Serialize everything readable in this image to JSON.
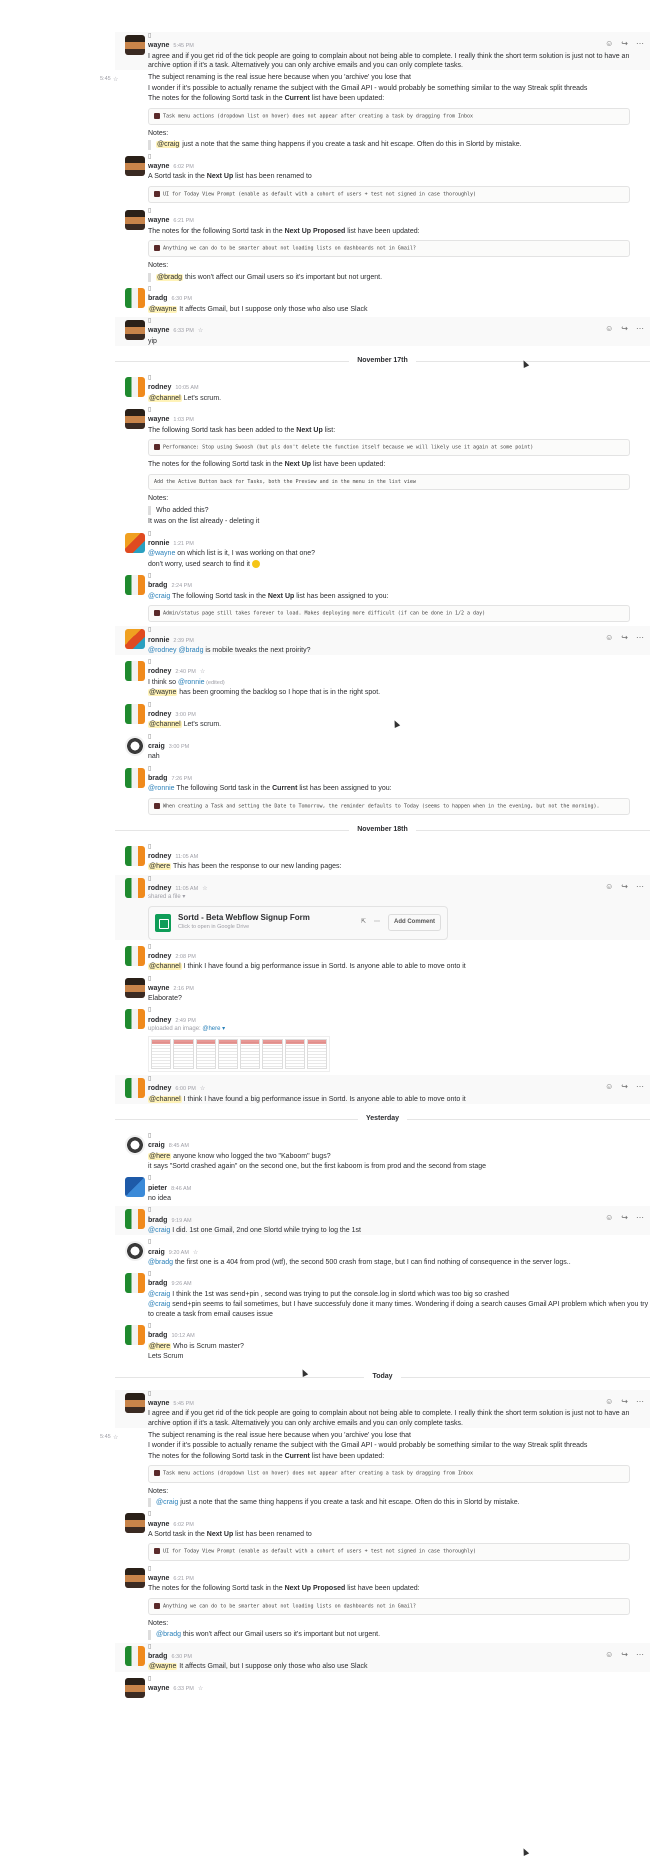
{
  "hover_actions": [
    "☺",
    "↪",
    "⋯"
  ],
  "days": [
    {
      "divider": "",
      "messages": [
        {
          "author": "wayne",
          "avatar": "wayne",
          "time": "5:45 PM",
          "lines": [
            {
              "t": "I agree and if you get rid of the tick people are going to complain about not being able to complete.  I really think the short term solution is just not to have an archive option if it's a task. Alternatively you can only archive emails and you can only complete tasks."
            }
          ],
          "hover": true
        },
        {
          "continued": true,
          "sidetime": "5:45",
          "star": true,
          "lines": [
            {
              "t": "The subject renaming is the real issue here because when you 'archive' you lose that"
            },
            {
              "t": "I wonder if it's possible to actually rename the subject with the Gmail API - would probably be something similar to the way Streak split threads"
            },
            {
              "t": "The notes for the following Sortd task in the ",
              "b": "Current",
              "t2": " list have been updated:"
            }
          ],
          "code": "Task menu actions (dropdown list on hover) does not appear after creating a task by dragging from Inbox",
          "notes": "Notes:",
          "quote": [
            {
              "m": "@craig",
              "t": " just a note that the same thing happens if you create a task and hit escape. Often do this in Slortd by mistake."
            }
          ]
        },
        {
          "author": "wayne",
          "avatar": "wayne",
          "time": "6:02 PM",
          "lines": [
            {
              "t": "A Sortd task in the ",
              "b": "Next Up",
              "t2": " list has been renamed to"
            }
          ],
          "code": "UI for Today View Prompt (enable as default with a cohort of users + test not signed in case thoroughly)"
        },
        {
          "author": "wayne",
          "avatar": "wayne",
          "time": "6:21 PM",
          "lines": [
            {
              "t": "The notes for the following Sortd task in the ",
              "b": "Next Up Proposed",
              "t2": " list have been updated:"
            }
          ],
          "code": "Anything we can do to be smarter about not loading lists on dashboards not in Gmail?",
          "notes": "Notes:",
          "quote": [
            {
              "m": "@bradg",
              "t": " this won't affect our Gmail users so it's important but not urgent."
            }
          ]
        },
        {
          "author": "bradg",
          "avatar": "bradg",
          "time": "6:30 PM",
          "lines": [
            {
              "m": "@wayne",
              "t": " It affects Gmail, but I suppose only those who also use Slack"
            }
          ]
        },
        {
          "author": "wayne",
          "avatar": "wayne",
          "time": "6:33 PM",
          "star": true,
          "lines": [
            {
              "t": "yip"
            }
          ],
          "hover": true
        }
      ]
    },
    {
      "divider": "November 17th",
      "messages": [
        {
          "author": "rodney",
          "avatar": "rodney",
          "time": "10:05 AM",
          "lines": [
            {
              "m": "@channel",
              "t": " Let's scrum."
            }
          ]
        },
        {
          "author": "wayne",
          "avatar": "wayne",
          "time": "1:03 PM",
          "lines": [
            {
              "t": "The following Sortd task has been added to the ",
              "b": "Next Up",
              "t2": " list:"
            }
          ],
          "code": "Performance: Stop using Swoosh (but pls don't delete the function itself because we will likely use it again at some point)",
          "lines2": [
            {
              "t": "The notes for the following Sortd task in the ",
              "b": "Next Up",
              "t2": " list have been updated:"
            }
          ],
          "code2": "Add the Active Button back for Tasks, both the Preview and in the menu in the list view",
          "notes": "Notes:",
          "quote": [
            {
              "t": "Who added this?"
            }
          ],
          "after": "It was on the list already - deleting it"
        },
        {
          "author": "ronnie",
          "avatar": "ronnie",
          "time": "1:21 PM",
          "lines": [
            {
              "mb": "@wayne",
              "t": " on which list is it, I was working on that one?"
            },
            {
              "t": "don't worry, used search to find it ",
              "emoji": true
            }
          ]
        },
        {
          "author": "bradg",
          "avatar": "bradg",
          "time": "2:24 PM",
          "lines": [
            {
              "mb": "@craig",
              "t": " The following Sortd task in the ",
              "b": "Next Up",
              "t2": " list has been assigned to you:"
            }
          ],
          "code": "Admin/status page still takes forever to load. Makes deploying more difficult (if can be done in 1/2 a day)"
        },
        {
          "author": "ronnie",
          "avatar": "ronnie",
          "time": "2:39 PM",
          "lines": [
            {
              "mb": "@rodney @bradg",
              "t": " is mobile tweaks the next proirity?"
            }
          ],
          "hover": true
        },
        {
          "author": "rodney",
          "avatar": "rodney",
          "time": "2:40 PM",
          "star": true,
          "lines": [
            {
              "t": "I think so ",
              "mb2": "@ronnie",
              "t3": "  (edited)"
            },
            {
              "m": "@wayne",
              "t": " has been grooming the backlog so I hope that is in the right spot."
            }
          ]
        },
        {
          "author": "rodney",
          "avatar": "rodney",
          "time": "3:00 PM",
          "lines": [
            {
              "m": "@channel",
              "t": " Let's scrum."
            }
          ]
        },
        {
          "author": "craig",
          "avatar": "craig",
          "time": "3:00 PM",
          "lines": [
            {
              "t": "nah"
            }
          ]
        },
        {
          "author": "bradg",
          "avatar": "bradg",
          "time": "7:26 PM",
          "lines": [
            {
              "mb": "@ronnie",
              "t": " The following Sortd task in the ",
              "b": "Current",
              "t2": " list has been assigned to you:"
            }
          ],
          "code": "When creating a Task and setting the Date to Tomorrow, the reminder defaults to Today (seems to happen when in the evening, but not the morning)."
        }
      ]
    },
    {
      "divider": "November 18th",
      "messages": [
        {
          "author": "rodney",
          "avatar": "rodney",
          "time": "11:05 AM",
          "lines": [
            {
              "m": "@here",
              "t": " This has been the response to our new landing pages:"
            }
          ]
        },
        {
          "author": "rodney",
          "avatar": "rodney",
          "time": "11:05 AM",
          "star": true,
          "shared": "shared a file ▾",
          "file": {
            "name": "Sortd - Beta Webflow Signup Form",
            "sub": "Click to open in Google Drive",
            "add": "Add Comment"
          },
          "hover": true
        },
        {
          "author": "rodney",
          "avatar": "rodney",
          "time": "2:08 PM",
          "lines": [
            {
              "m": "@channel",
              "t": " I think I have found a big performance issue in Sortd.  Is anyone able to able to move onto it"
            }
          ]
        },
        {
          "author": "wayne",
          "avatar": "wayne",
          "time": "2:16 PM",
          "lines": [
            {
              "t": "Elaborate?"
            }
          ]
        },
        {
          "author": "rodney",
          "avatar": "rodney",
          "time": "2:49 PM",
          "shared": "uploaded an image: ",
          "sharedm": "@here ▾",
          "image": true
        },
        {
          "author": "rodney",
          "avatar": "rodney",
          "time": "6:00 PM",
          "star": true,
          "lines": [
            {
              "m": "@channel",
              "t": " I think I have found a big performance issue in Sortd.  Is anyone able to able to move onto it"
            }
          ],
          "hover": true
        }
      ]
    },
    {
      "divider": "Yesterday",
      "messages": [
        {
          "author": "craig",
          "avatar": "craig",
          "time": "8:45 AM",
          "lines": [
            {
              "m": "@here",
              "t": " anyone know who logged the two \"Kaboom\" bugs?"
            },
            {
              "t": "it says \"Sortd crashed again\" on the second one, but the first kaboom is from prod and the second from stage"
            }
          ]
        },
        {
          "author": "pieter",
          "avatar": "pieter",
          "time": "8:46 AM",
          "lines": [
            {
              "t": "no idea"
            }
          ]
        },
        {
          "author": "bradg",
          "avatar": "bradg",
          "time": "9:19 AM",
          "lines": [
            {
              "mb": "@craig",
              "t": " I did. 1st one Gmail, 2nd one Slortd while trying to log the 1st"
            }
          ],
          "hover": true
        },
        {
          "author": "craig",
          "avatar": "craig",
          "time": "9:20 AM",
          "star": true,
          "lines": [
            {
              "mb": "@bradg",
              "t": " the first one is a 404 from prod (wtf), the second 500 crash from stage, but I can find nothing of consequence in the server logs.."
            }
          ]
        },
        {
          "author": "bradg",
          "avatar": "bradg",
          "time": "9:26 AM",
          "lines": [
            {
              "mb": "@craig",
              "t": " I think the 1st was send+pin , second was trying to put the console.log in slortd which was too big so crashed"
            },
            {
              "mb": "@craig",
              "t": " send+pin seems to fail sometimes, but I have successfuly done it many times. Wondering if doing  a search causes Gmail API problem which when you try to create a task from email causes issue"
            }
          ]
        },
        {
          "author": "bradg",
          "avatar": "bradg",
          "time": "10:12 AM",
          "lines": [
            {
              "m": "@here",
              "t": " Who is Scrum master?"
            },
            {
              "t": "Lets Scrum"
            }
          ]
        }
      ]
    },
    {
      "divider": "Today",
      "messages": [
        {
          "author": "wayne",
          "avatar": "wayne",
          "time": "5:45 PM",
          "lines": [
            {
              "t": "I agree and if you get rid of the tick people are going to complain about not being able to complete.  I really think the short term solution is just not to have an archive option if it's a task. Alternatively you can only archive emails and you can only complete tasks."
            }
          ],
          "hover": true
        },
        {
          "continued": true,
          "sidetime": "5:45",
          "star": true,
          "lines": [
            {
              "t": "The subject renaming is the real issue here because when you 'archive' you lose that"
            },
            {
              "t": "I wonder if it's possible to actually rename the subject with the Gmail API - would probably be something similar to the way Streak split threads"
            },
            {
              "t": "The notes for the following Sortd task in the ",
              "b": "Current",
              "t2": " list have been updated:"
            }
          ],
          "code": "Task menu actions (dropdown list on hover) does not appear after creating a task by dragging from Inbox",
          "notes": "Notes:",
          "quote": [
            {
              "mb": "@craig",
              "t": " just a note that the same thing happens if you create a task and hit escape. Often do this in Slortd by mistake."
            }
          ]
        },
        {
          "author": "wayne",
          "avatar": "wayne",
          "time": "6:02 PM",
          "lines": [
            {
              "t": "A Sortd task in the ",
              "b": "Next Up",
              "t2": " list has been renamed to"
            }
          ],
          "code": "UI for Today View Prompt (enable as default with a cohort of users + test not signed in case thoroughly)"
        },
        {
          "author": "wayne",
          "avatar": "wayne",
          "time": "6:21 PM",
          "lines": [
            {
              "t": "The notes for the following Sortd task in the ",
              "b": "Next Up Proposed",
              "t2": " list have been updated:"
            }
          ],
          "code": "Anything we can do to be smarter about not loading lists on dashboards not in Gmail?",
          "notes": "Notes:",
          "quote": [
            {
              "mb": "@bradg",
              "t": " this won't affect our Gmail users so it's important but not urgent."
            }
          ]
        },
        {
          "author": "bradg",
          "avatar": "bradg",
          "time": "6:30 PM",
          "lines": [
            {
              "m": "@wayne",
              "t": " It affects Gmail, but I suppose only those who also use Slack"
            }
          ],
          "hover": true
        },
        {
          "author": "wayne",
          "avatar": "wayne",
          "time": "6:33 PM",
          "star": true,
          "lines": []
        }
      ]
    }
  ]
}
